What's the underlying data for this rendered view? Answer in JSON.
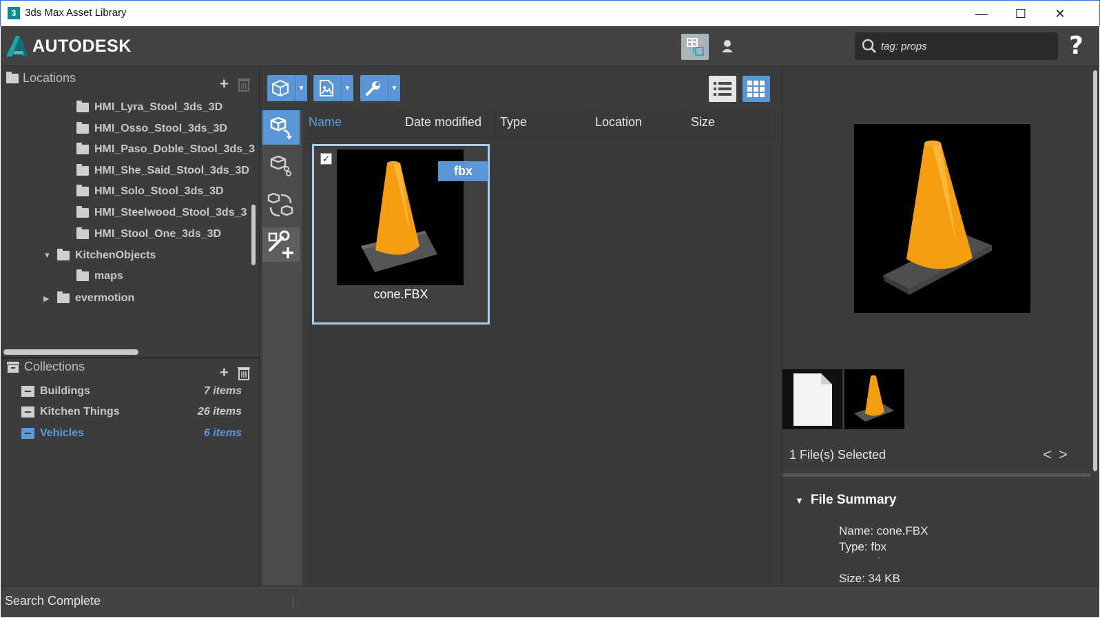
{
  "window": {
    "title": "3ds Max Asset Library",
    "app_icon_glyph": "3",
    "minimize": "—",
    "maximize": "☐",
    "close": "✕"
  },
  "header": {
    "brand": "AUTODESK",
    "search_value": "tag: props",
    "help": "?"
  },
  "locations": {
    "title": "Locations",
    "items": [
      {
        "label": "HMI_Lyra_Stool_3ds_3D"
      },
      {
        "label": "HMI_Osso_Stool_3ds_3D"
      },
      {
        "label": "HMI_Paso_Doble_Stool_3ds_3"
      },
      {
        "label": "HMI_She_Said_Stool_3ds_3D"
      },
      {
        "label": "HMI_Solo_Stool_3ds_3D"
      },
      {
        "label": "HMI_Steelwood_Stool_3ds_3"
      },
      {
        "label": "HMI_Stool_One_3ds_3D"
      },
      {
        "label": "KitchenObjects"
      },
      {
        "label": "maps"
      },
      {
        "label": "evermotion"
      }
    ]
  },
  "collections": {
    "title": "Collections",
    "items": [
      {
        "label": "Buildings",
        "count": "7 items"
      },
      {
        "label": "Kitchen Things",
        "count": "26 items"
      },
      {
        "label": "Vehicles",
        "count": "6 items"
      }
    ]
  },
  "columns": [
    "Name",
    "Date modified",
    "Type",
    "Location",
    "Size"
  ],
  "asset": {
    "name": "cone.FBX",
    "badge": "fbx",
    "checked": "✓"
  },
  "details": {
    "selected": "1 File(s) Selected",
    "summary_title": "File Summary",
    "name_line": "Name: cone.FBX",
    "type_line": "Type: fbx",
    "dash": "-",
    "size_line": "Size: 34 KB"
  },
  "status": {
    "text": "Search Complete"
  },
  "colors": {
    "accent": "#5a95d6",
    "bg": "#3c3c3c",
    "cone": "#f59e12"
  }
}
